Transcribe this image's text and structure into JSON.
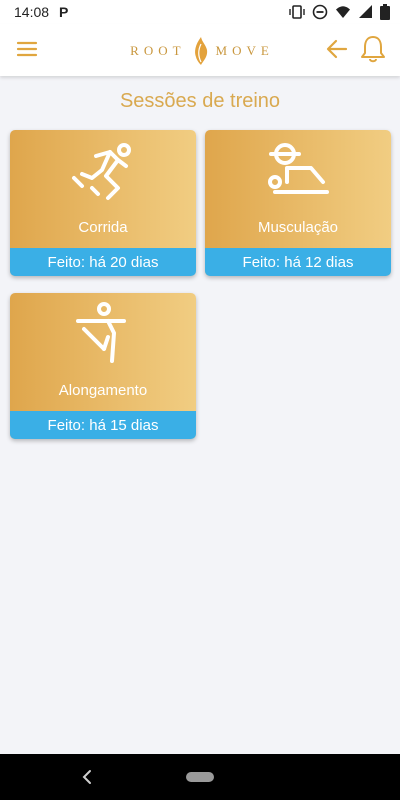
{
  "status_bar": {
    "time": "14:08",
    "notification_letter": "P"
  },
  "app_bar": {
    "logo_left": "ROOT",
    "logo_right": "MOVE",
    "accent_color": "#e0a63f"
  },
  "page": {
    "title": "Sessões de treino"
  },
  "sessions": [
    {
      "label": "Corrida",
      "status": "Feito: há 20 dias",
      "icon": "running-icon"
    },
    {
      "label": "Musculação",
      "status": "Feito: há 12 dias",
      "icon": "weightlifting-icon"
    },
    {
      "label": "Alongamento",
      "status": "Feito: há 15 dias",
      "icon": "stretching-icon"
    }
  ],
  "colors": {
    "card_gradient_start": "#dfa64c",
    "card_gradient_end": "#f1cd82",
    "status_strip": "#3aafe6",
    "title": "#d9a950",
    "background": "#f3f4f8"
  }
}
